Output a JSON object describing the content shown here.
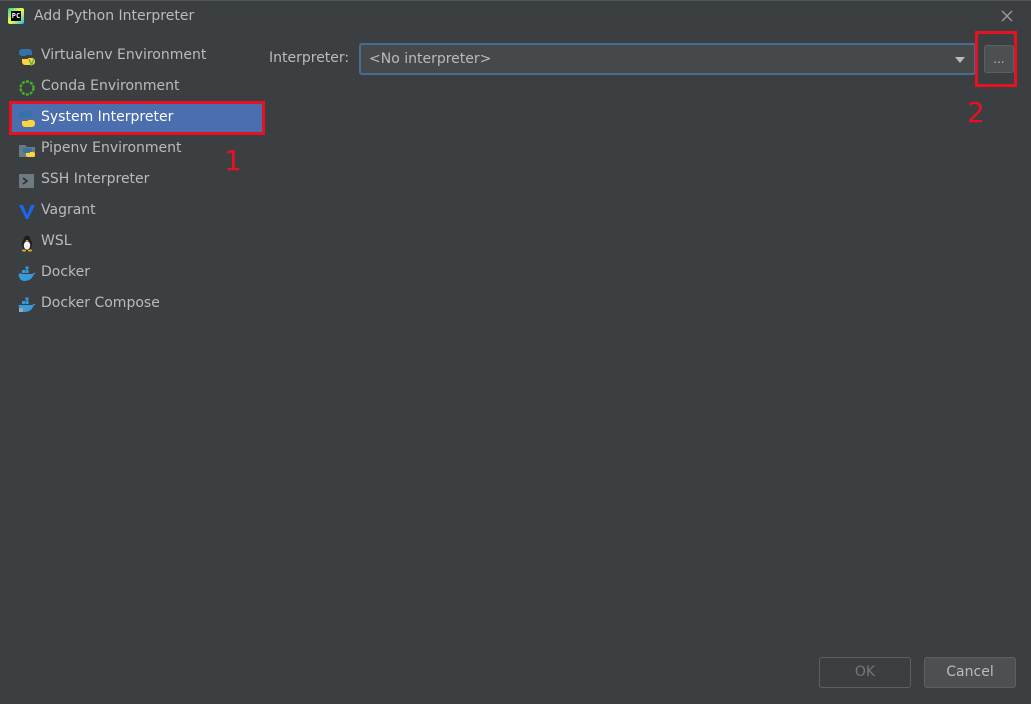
{
  "window": {
    "title": "Add Python Interpreter"
  },
  "sidebar": {
    "items": [
      {
        "label": "Virtualenv Environment",
        "icon": "python-virtualenv-icon"
      },
      {
        "label": "Conda Environment",
        "icon": "conda-icon"
      },
      {
        "label": "System Interpreter",
        "icon": "python-icon",
        "selected": true
      },
      {
        "label": "Pipenv Environment",
        "icon": "pipenv-icon"
      },
      {
        "label": "SSH Interpreter",
        "icon": "ssh-terminal-icon"
      },
      {
        "label": "Vagrant",
        "icon": "vagrant-icon"
      },
      {
        "label": "WSL",
        "icon": "linux-penguin-icon"
      },
      {
        "label": "Docker",
        "icon": "docker-icon"
      },
      {
        "label": "Docker Compose",
        "icon": "docker-compose-icon"
      }
    ]
  },
  "main": {
    "interpreter_label": "Interpreter:",
    "interpreter_value": "<No interpreter>",
    "browse_label": "..."
  },
  "annotations": {
    "marker1": "1",
    "marker2": "2"
  },
  "footer": {
    "ok_label": "OK",
    "cancel_label": "Cancel"
  },
  "colors": {
    "background": "#3c3f41",
    "selection": "#4b6eaf",
    "annotation_red": "#e81123",
    "focus_border": "#466d94"
  }
}
